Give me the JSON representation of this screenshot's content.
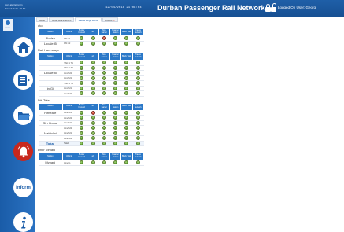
{
  "header": {
    "left_line1": "Acc: ala fat nn rn",
    "left_line2": "Traced: Auth. 20 Mf",
    "clock": "12/04/2018 21:08:04",
    "title": "Durban Passenger Rail Network",
    "user_label": "Logged On User: Georg"
  },
  "sidebar": {
    "top_tab_label": "LOCAL",
    "info_label": "inform"
  },
  "tabs": [
    {
      "label": "Menu",
      "active": false,
      "closable": false
    },
    {
      "label": "Mode de aSmte ent",
      "active": false,
      "closable": false
    },
    {
      "label": "Valeria Ringo Ma ua",
      "active": true,
      "closable": false
    },
    {
      "label": "Mbt Btt",
      "active": false,
      "closable": true
    }
  ],
  "columns": [
    "Station",
    "Vehicle",
    "Bunker Inbound",
    "a0",
    "Side Barrier",
    "Boarder Station",
    "Block Train",
    "Tracks Network"
  ],
  "sections": [
    {
      "title": "uto",
      "rows": [
        {
          "train": "Bhoise",
          "vehicle": "PM 61",
          "status": [
            "g",
            "g",
            "r",
            "g",
            "g",
            "g"
          ]
        },
        {
          "train": "Locale l5",
          "vehicle": "PM 62",
          "status": [
            "g",
            "g",
            "g",
            "g",
            "g",
            "g"
          ]
        }
      ]
    },
    {
      "title": "Rail Hanmaaye",
      "rows": [
        {
          "train": "",
          "vehicle": "TAR 1 T1",
          "status": [
            "g",
            "g",
            "g",
            "g",
            "g",
            "g"
          ]
        },
        {
          "train": "",
          "vehicle": "TAR 1 T2",
          "status": [
            "g",
            "g",
            "g",
            "g",
            "g",
            "g"
          ]
        },
        {
          "train": "Locale l5",
          "vehicle": "Lms M2",
          "status": [
            "g",
            "g",
            "g",
            "g",
            "g",
            "g"
          ]
        },
        {
          "train": "",
          "vehicle": "Lms M1",
          "status": [
            "g",
            "g",
            "g",
            "g",
            "g",
            "g"
          ]
        },
        {
          "train": "",
          "vehicle": "TAR 1 T1",
          "status": [
            "g",
            "g",
            "g",
            "g",
            "g",
            "g"
          ]
        },
        {
          "train": "in Gi",
          "vehicle": "Lms M1",
          "status": [
            "g",
            "g",
            "g",
            "g",
            "g",
            "g"
          ]
        },
        {
          "train": "",
          "vehicle": "Lms M2",
          "status": [
            "g",
            "g",
            "g",
            "g",
            "g",
            "g"
          ]
        }
      ]
    },
    {
      "title": "Dit. Tuie",
      "rows": [
        {
          "train": "Pirneare",
          "vehicle": "Line M1",
          "status": [
            "g",
            "r",
            "g",
            "g",
            "g",
            "g"
          ]
        },
        {
          "train": "",
          "vehicle": "Line M2",
          "status": [
            "g",
            "g",
            "g",
            "g",
            "g",
            "g"
          ]
        },
        {
          "train": "Stn Hmise",
          "vehicle": "Line M1",
          "status": [
            "g",
            "g",
            "g",
            "g",
            "g",
            "g"
          ]
        },
        {
          "train": "",
          "vehicle": "Line M2",
          "status": [
            "g",
            "g",
            "g",
            "g",
            "g",
            "g"
          ]
        },
        {
          "train": "Mabiolini",
          "vehicle": "Line M1",
          "status": [
            "g",
            "g",
            "g",
            "g",
            "g",
            "g"
          ]
        },
        {
          "train": "",
          "vehicle": "Line M2",
          "status": [
            "g",
            "g",
            "g",
            "g",
            "g",
            "g"
          ]
        },
        {
          "train": "Tokal",
          "vehicle": "Total",
          "status": [
            "g",
            "g",
            "g",
            "g",
            "g",
            "g"
          ],
          "total": true
        }
      ]
    },
    {
      "title": "Dner Stmani",
      "rows": [
        {
          "train": "Mybani",
          "vehicle": "Line G",
          "status": [
            "g",
            "g",
            "g",
            "g",
            "g",
            "g"
          ]
        }
      ]
    }
  ],
  "colors": {
    "header_blue": "#1f5fa8",
    "table_header": "#2a78c8",
    "ok": "#5fa334",
    "fault": "#d84430"
  }
}
